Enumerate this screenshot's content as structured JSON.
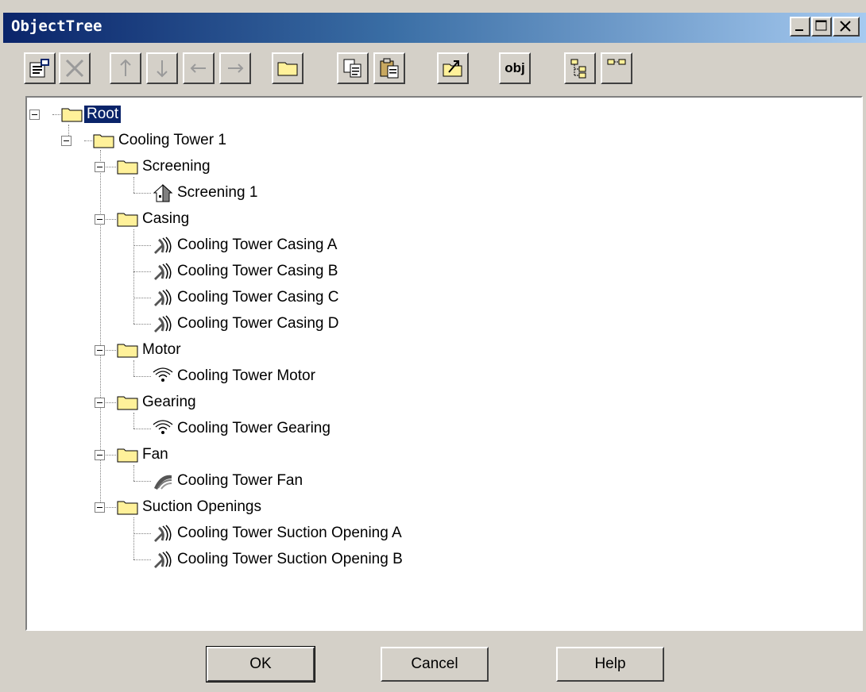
{
  "window": {
    "title": "ObjectTree"
  },
  "toolbar": {
    "buttons": [
      {
        "icon": "properties-icon",
        "enabled": true
      },
      {
        "icon": "delete-icon",
        "enabled": false
      },
      {
        "icon": "move-up-icon",
        "enabled": false
      },
      {
        "icon": "move-down-icon",
        "enabled": false
      },
      {
        "icon": "move-left-icon",
        "enabled": false
      },
      {
        "icon": "move-right-icon",
        "enabled": false
      },
      {
        "icon": "new-folder-icon",
        "enabled": true
      },
      {
        "icon": "copy-icon",
        "enabled": true
      },
      {
        "icon": "paste-icon",
        "enabled": true
      },
      {
        "icon": "import-folder-icon",
        "enabled": true
      },
      {
        "icon": "object-icon",
        "enabled": true,
        "label": "obj"
      },
      {
        "icon": "expand-tree-icon",
        "enabled": true
      },
      {
        "icon": "collapse-tree-icon",
        "enabled": true
      }
    ]
  },
  "tree": {
    "root": "Root",
    "tower": "Cooling Tower 1",
    "screening": {
      "label": "Screening",
      "children": [
        "Screening 1"
      ]
    },
    "casing": {
      "label": "Casing",
      "children": [
        "Cooling Tower Casing A",
        "Cooling Tower Casing B",
        "Cooling Tower Casing C",
        "Cooling Tower Casing D"
      ]
    },
    "motor": {
      "label": "Motor",
      "children": [
        "Cooling Tower Motor"
      ]
    },
    "gearing": {
      "label": "Gearing",
      "children": [
        "Cooling Tower Gearing"
      ]
    },
    "fan": {
      "label": "Fan",
      "children": [
        "Cooling Tower Fan"
      ]
    },
    "suction": {
      "label": "Suction Openings",
      "children": [
        "Cooling Tower Suction Opening A",
        "Cooling Tower Suction Opening B"
      ]
    }
  },
  "buttons": {
    "ok": "OK",
    "cancel": "Cancel",
    "help": "Help"
  },
  "colors": {
    "titlebar_start": "#0a246a",
    "selection": "#0a246a",
    "folder": "#fff19a"
  }
}
